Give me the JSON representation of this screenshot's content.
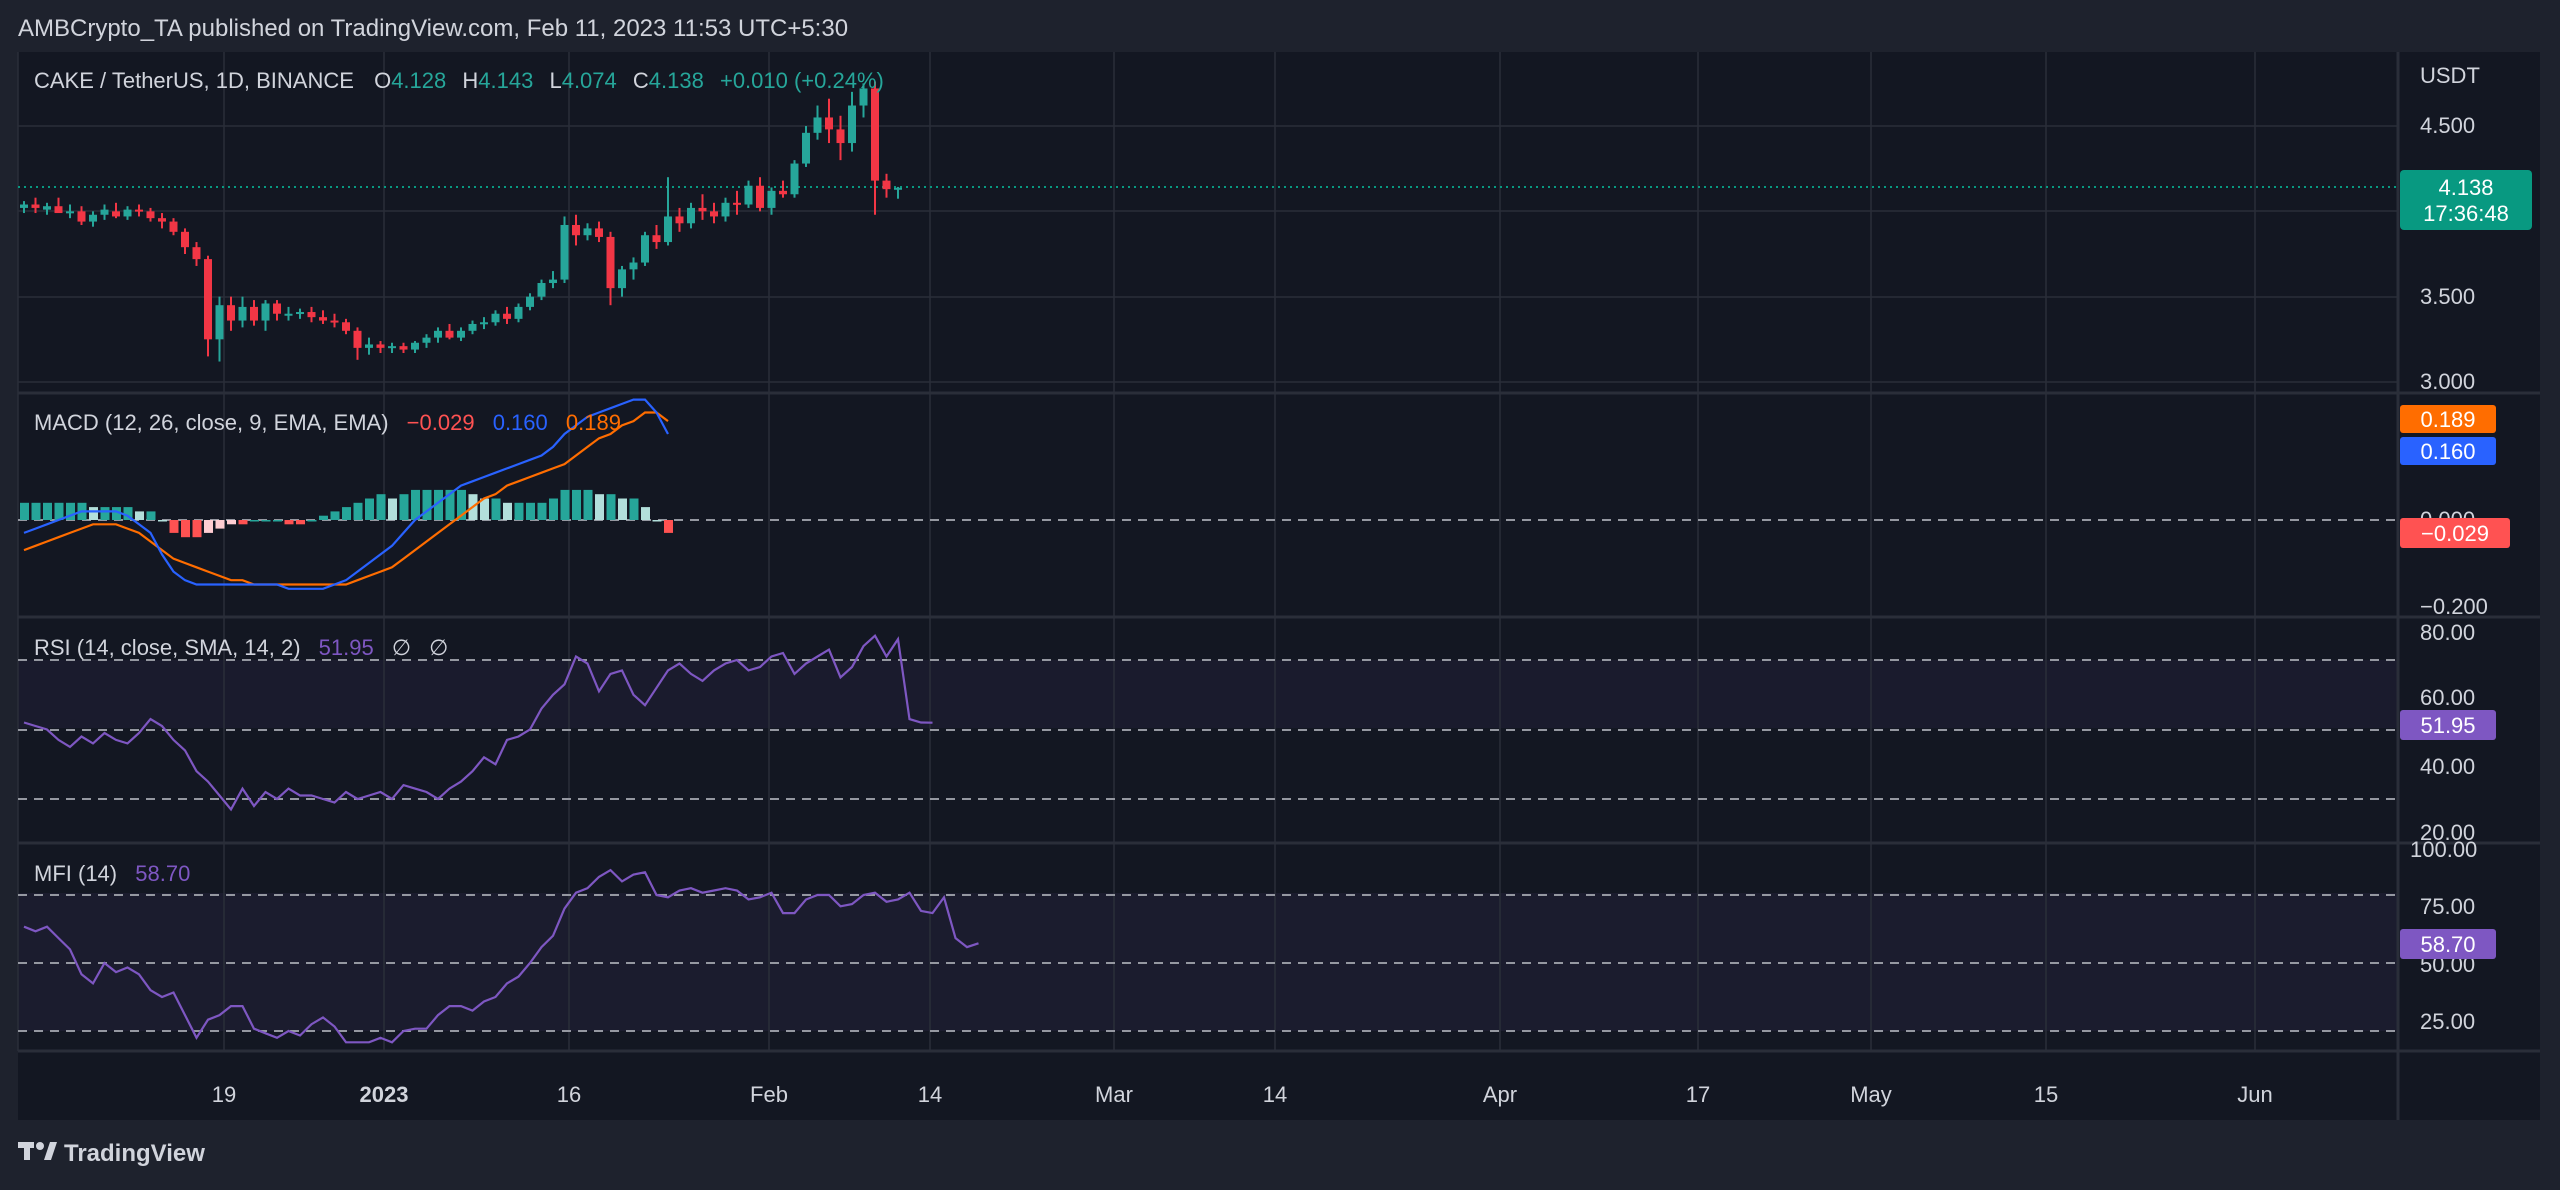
{
  "header": {
    "published_by": "AMBCrypto_TA published on TradingView.com, Feb 11, 2023 11:53 UTC+5:30"
  },
  "footer": {
    "brand": "TradingView"
  },
  "colors": {
    "up": "#26a69a",
    "down": "#f23645",
    "macd_line": "#2962ff",
    "signal_line": "#ff6d00",
    "hist_up": "#26a69a",
    "hist_up_fading": "#b2dfdb",
    "hist_down": "#ff5252",
    "hist_down_fading": "#ffcdd2",
    "rsi": "#7e57c2",
    "mfi": "#7e57c2",
    "last_price_tag": "#089981"
  },
  "price_pane": {
    "symbol": "CAKE / TetherUS, 1D, BINANCE",
    "o_label": "O",
    "o_value": "4.128",
    "h_label": "H",
    "h_value": "4.143",
    "l_label": "L",
    "l_value": "4.074",
    "c_label": "C",
    "c_value": "4.138",
    "change": "+0.010 (+0.24%)",
    "currency": "USDT",
    "y_ticks": [
      "4.500",
      "3.500",
      "3.000"
    ],
    "last_price": "4.138",
    "countdown": "17:36:48"
  },
  "macd_pane": {
    "title": "MACD (12, 26, close, 9, EMA, EMA)",
    "histogram_value": "−0.029",
    "macd_value": "0.160",
    "signal_value": "0.189",
    "y_ticks": [
      "0.000",
      "−0.200"
    ],
    "tag_signal": "0.189",
    "tag_macd": "0.160",
    "tag_hist": "−0.029"
  },
  "rsi_pane": {
    "title": "RSI (14, close, SMA, 14, 2)",
    "value": "51.95",
    "na1": "∅",
    "na2": "∅",
    "y_ticks": [
      "80.00",
      "60.00",
      "40.00",
      "20.00"
    ],
    "tag": "51.95"
  },
  "mfi_pane": {
    "title": "MFI (14)",
    "value": "58.70",
    "y_ticks": [
      "100.00",
      "75.00",
      "50.00",
      "25.00"
    ],
    "tag": "58.70"
  },
  "x_axis": {
    "labels": [
      "19",
      "2023",
      "16",
      "Feb",
      "14",
      "Mar",
      "14",
      "Apr",
      "17",
      "May",
      "15",
      "Jun"
    ]
  },
  "chart_data": [
    {
      "type": "candlestick",
      "title": "CAKE / TetherUS, 1D, BINANCE",
      "ylabel": "USDT",
      "ylim": [
        2.95,
        4.85
      ],
      "x_start": "2022-12-02",
      "ohlc": [
        [
          4.02,
          4.06,
          3.99,
          4.04
        ],
        [
          4.04,
          4.08,
          3.99,
          4.02
        ],
        [
          4.01,
          4.05,
          3.98,
          4.03
        ],
        [
          4.03,
          4.08,
          4.0,
          3.99
        ],
        [
          3.99,
          4.04,
          3.96,
          4.0
        ],
        [
          4.0,
          4.03,
          3.92,
          3.94
        ],
        [
          3.94,
          4.0,
          3.91,
          3.98
        ],
        [
          3.98,
          4.04,
          3.95,
          4.01
        ],
        [
          4.0,
          4.05,
          3.96,
          3.97
        ],
        [
          3.97,
          4.03,
          3.95,
          4.01
        ],
        [
          4.01,
          4.04,
          3.97,
          4.0
        ],
        [
          4.0,
          4.02,
          3.94,
          3.96
        ],
        [
          3.96,
          3.99,
          3.9,
          3.94
        ],
        [
          3.94,
          3.96,
          3.86,
          3.88
        ],
        [
          3.88,
          3.9,
          3.75,
          3.79
        ],
        [
          3.79,
          3.82,
          3.68,
          3.72
        ],
        [
          3.72,
          3.74,
          3.15,
          3.25
        ],
        [
          3.25,
          3.5,
          3.12,
          3.45
        ],
        [
          3.45,
          3.5,
          3.3,
          3.36
        ],
        [
          3.36,
          3.5,
          3.32,
          3.44
        ],
        [
          3.44,
          3.48,
          3.33,
          3.36
        ],
        [
          3.36,
          3.48,
          3.3,
          3.46
        ],
        [
          3.46,
          3.48,
          3.36,
          3.4
        ],
        [
          3.4,
          3.44,
          3.36,
          3.4
        ],
        [
          3.4,
          3.43,
          3.37,
          3.41
        ],
        [
          3.41,
          3.44,
          3.35,
          3.38
        ],
        [
          3.38,
          3.42,
          3.34,
          3.36
        ],
        [
          3.36,
          3.4,
          3.32,
          3.35
        ],
        [
          3.35,
          3.37,
          3.28,
          3.3
        ],
        [
          3.3,
          3.32,
          3.13,
          3.2
        ],
        [
          3.2,
          3.26,
          3.16,
          3.22
        ],
        [
          3.22,
          3.24,
          3.17,
          3.2
        ],
        [
          3.2,
          3.23,
          3.17,
          3.21
        ],
        [
          3.21,
          3.23,
          3.17,
          3.19
        ],
        [
          3.19,
          3.24,
          3.17,
          3.23
        ],
        [
          3.23,
          3.28,
          3.2,
          3.26
        ],
        [
          3.26,
          3.32,
          3.23,
          3.3
        ],
        [
          3.3,
          3.34,
          3.25,
          3.26
        ],
        [
          3.26,
          3.32,
          3.24,
          3.3
        ],
        [
          3.3,
          3.36,
          3.28,
          3.34
        ],
        [
          3.34,
          3.38,
          3.31,
          3.35
        ],
        [
          3.35,
          3.42,
          3.33,
          3.4
        ],
        [
          3.4,
          3.44,
          3.34,
          3.37
        ],
        [
          3.37,
          3.46,
          3.35,
          3.44
        ],
        [
          3.44,
          3.52,
          3.42,
          3.5
        ],
        [
          3.5,
          3.6,
          3.48,
          3.58
        ],
        [
          3.58,
          3.65,
          3.55,
          3.6
        ],
        [
          3.6,
          3.97,
          3.58,
          3.92
        ],
        [
          3.92,
          3.98,
          3.8,
          3.86
        ],
        [
          3.86,
          3.93,
          3.83,
          3.9
        ],
        [
          3.9,
          3.94,
          3.82,
          3.85
        ],
        [
          3.85,
          3.88,
          3.45,
          3.55
        ],
        [
          3.55,
          3.68,
          3.5,
          3.66
        ],
        [
          3.66,
          3.73,
          3.6,
          3.7
        ],
        [
          3.7,
          3.88,
          3.68,
          3.86
        ],
        [
          3.86,
          3.92,
          3.78,
          3.82
        ],
        [
          3.82,
          4.2,
          3.8,
          3.97
        ],
        [
          3.97,
          4.02,
          3.88,
          3.93
        ],
        [
          3.93,
          4.05,
          3.9,
          4.02
        ],
        [
          4.02,
          4.1,
          3.95,
          4.0
        ],
        [
          4.0,
          4.05,
          3.93,
          3.97
        ],
        [
          3.97,
          4.08,
          3.94,
          4.05
        ],
        [
          4.05,
          4.12,
          3.98,
          4.04
        ],
        [
          4.04,
          4.18,
          4.02,
          4.15
        ],
        [
          4.15,
          4.2,
          4.0,
          4.02
        ],
        [
          4.02,
          4.14,
          3.98,
          4.12
        ],
        [
          4.12,
          4.18,
          4.08,
          4.1
        ],
        [
          4.1,
          4.3,
          4.08,
          4.28
        ],
        [
          4.28,
          4.5,
          4.26,
          4.46
        ],
        [
          4.46,
          4.62,
          4.42,
          4.55
        ],
        [
          4.55,
          4.66,
          4.4,
          4.48
        ],
        [
          4.48,
          4.56,
          4.3,
          4.4
        ],
        [
          4.4,
          4.7,
          4.35,
          4.62
        ],
        [
          4.62,
          4.75,
          4.55,
          4.72
        ],
        [
          4.72,
          4.76,
          3.98,
          4.18
        ],
        [
          4.18,
          4.22,
          4.08,
          4.13
        ],
        [
          4.128,
          4.143,
          4.074,
          4.138
        ]
      ]
    },
    {
      "type": "line",
      "title": "MACD (12, 26, close, 9, EMA, EMA)",
      "ylim": [
        -0.2,
        0.3
      ],
      "series": [
        {
          "name": "MACD",
          "values": [
            -0.03,
            -0.02,
            -0.01,
            0.0,
            0.01,
            0.02,
            0.02,
            0.02,
            0.02,
            0.01,
            -0.01,
            -0.03,
            -0.08,
            -0.12,
            -0.14,
            -0.15,
            -0.15,
            -0.15,
            -0.15,
            -0.15,
            -0.15,
            -0.15,
            -0.15,
            -0.16,
            -0.16,
            -0.16,
            -0.16,
            -0.15,
            -0.14,
            -0.12,
            -0.1,
            -0.08,
            -0.06,
            -0.03,
            0.0,
            0.02,
            0.04,
            0.06,
            0.08,
            0.09,
            0.1,
            0.11,
            0.12,
            0.13,
            0.14,
            0.15,
            0.17,
            0.2,
            0.22,
            0.24,
            0.25,
            0.26,
            0.27,
            0.28,
            0.28,
            0.25,
            0.2
          ]
        },
        {
          "name": "Signal",
          "values": [
            -0.07,
            -0.06,
            -0.05,
            -0.04,
            -0.03,
            -0.02,
            -0.01,
            -0.01,
            -0.01,
            -0.02,
            -0.03,
            -0.05,
            -0.07,
            -0.09,
            -0.1,
            -0.11,
            -0.12,
            -0.13,
            -0.14,
            -0.14,
            -0.15,
            -0.15,
            -0.15,
            -0.15,
            -0.15,
            -0.15,
            -0.15,
            -0.15,
            -0.15,
            -0.14,
            -0.13,
            -0.12,
            -0.11,
            -0.09,
            -0.07,
            -0.05,
            -0.03,
            -0.01,
            0.01,
            0.03,
            0.05,
            0.06,
            0.08,
            0.09,
            0.1,
            0.11,
            0.12,
            0.13,
            0.15,
            0.17,
            0.19,
            0.2,
            0.22,
            0.23,
            0.25,
            0.25,
            0.23
          ]
        },
        {
          "name": "Histogram",
          "values": [
            0.04,
            0.04,
            0.04,
            0.04,
            0.04,
            0.04,
            0.03,
            0.03,
            0.03,
            0.03,
            0.02,
            0.02,
            0.0,
            -0.03,
            -0.04,
            -0.04,
            -0.03,
            -0.02,
            -0.01,
            -0.01,
            0.0,
            0.0,
            0.0,
            -0.01,
            -0.01,
            0.0,
            0.01,
            0.02,
            0.03,
            0.04,
            0.05,
            0.06,
            0.05,
            0.06,
            0.07,
            0.07,
            0.07,
            0.07,
            0.07,
            0.06,
            0.05,
            0.05,
            0.04,
            0.04,
            0.04,
            0.04,
            0.05,
            0.07,
            0.07,
            0.07,
            0.06,
            0.06,
            0.05,
            0.05,
            0.03,
            0.0,
            -0.03
          ]
        }
      ]
    },
    {
      "type": "line",
      "title": "RSI (14, close, SMA, 14, 2)",
      "ylim": [
        20,
        80
      ],
      "series": [
        {
          "name": "RSI",
          "values": [
            52,
            51,
            50,
            47,
            45,
            48,
            46,
            49,
            47,
            46,
            49,
            53,
            51,
            47,
            44,
            38,
            35,
            31,
            27,
            33,
            28,
            32,
            30,
            33,
            31,
            31,
            30,
            29,
            32,
            30,
            31,
            32,
            30,
            34,
            33,
            32,
            30,
            33,
            35,
            38,
            42,
            40,
            47,
            48,
            50,
            56,
            60,
            63,
            71,
            69,
            61,
            66,
            67,
            60,
            57,
            62,
            67,
            69,
            66,
            64,
            67,
            69,
            70,
            67,
            68,
            71,
            72,
            66,
            69,
            71,
            73,
            65,
            68,
            74,
            77,
            71,
            76,
            53,
            52,
            51.95
          ]
        }
      ]
    },
    {
      "type": "line",
      "title": "MFI (14)",
      "ylim": [
        0,
        100
      ],
      "series": [
        {
          "name": "MFI",
          "values": [
            66,
            64,
            66,
            61,
            56,
            45,
            41,
            50,
            46,
            48,
            45,
            38,
            35,
            37,
            27,
            17,
            25,
            27,
            31,
            31,
            21,
            19,
            17,
            20,
            18,
            23,
            26,
            22,
            15,
            15,
            15,
            17,
            15,
            20,
            21,
            21,
            27,
            31,
            31,
            29,
            33,
            35,
            41,
            44,
            50,
            57,
            62,
            74,
            81,
            83,
            88,
            91,
            86,
            89,
            90,
            80,
            79,
            82,
            83,
            81,
            82,
            83,
            82,
            78,
            79,
            81,
            72,
            72,
            78,
            80,
            80,
            75,
            76,
            80,
            81,
            77,
            78,
            81,
            73,
            72,
            79,
            61,
            57,
            58.7
          ]
        }
      ]
    }
  ]
}
